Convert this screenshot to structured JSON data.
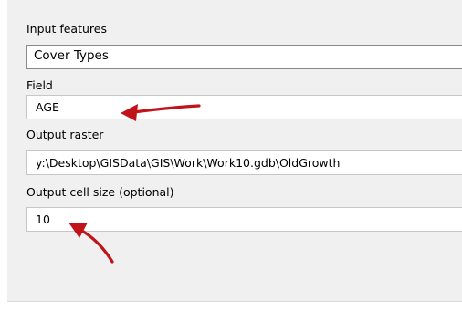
{
  "form": {
    "input_features": {
      "label": "Input features",
      "value": "Cover Types"
    },
    "field": {
      "label": "Field",
      "value": "AGE"
    },
    "output_raster": {
      "label": "Output raster",
      "value": "y:\\Desktop\\GISData\\GIS\\Work\\Work10.gdb\\OldGrowth"
    },
    "output_cell_size": {
      "label": "Output cell size (optional)",
      "value": "10"
    }
  },
  "annotations": {
    "arrow_color": "#c0141a"
  }
}
